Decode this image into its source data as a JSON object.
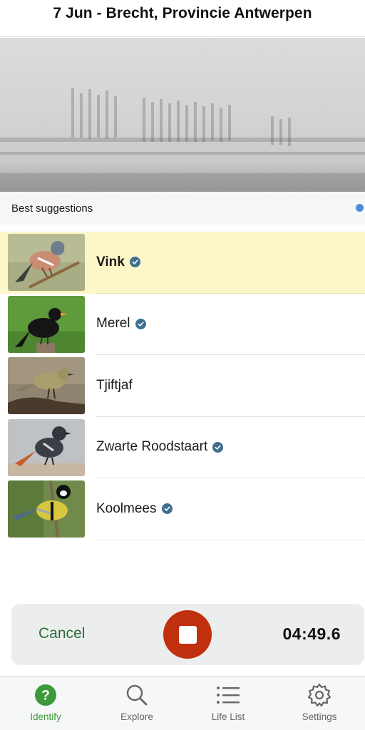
{
  "header": {
    "title": "7 Jun - Brecht, Provincie Antwerpen"
  },
  "suggestions": {
    "label": "Best suggestions",
    "items": [
      {
        "name": "Vink",
        "verified": true,
        "selected": true,
        "thumb_icon": "chaffinch-photo"
      },
      {
        "name": "Merel",
        "verified": true,
        "selected": false,
        "thumb_icon": "blackbird-photo"
      },
      {
        "name": "Tjiftjaf",
        "verified": false,
        "selected": false,
        "thumb_icon": "chiffchaff-photo"
      },
      {
        "name": "Zwarte Roodstaart",
        "verified": true,
        "selected": false,
        "thumb_icon": "black-redstart-photo"
      },
      {
        "name": "Koolmees",
        "verified": true,
        "selected": false,
        "thumb_icon": "great-tit-photo"
      }
    ]
  },
  "recording": {
    "cancel_label": "Cancel",
    "timer": "04:49.6",
    "stop_color": "#c1300e"
  },
  "tabs": [
    {
      "label": "Identify",
      "icon": "question-circle-icon",
      "active": true
    },
    {
      "label": "Explore",
      "icon": "search-icon",
      "active": false
    },
    {
      "label": "Life List",
      "icon": "list-icon",
      "active": false
    },
    {
      "label": "Settings",
      "icon": "gear-icon",
      "active": false
    }
  ],
  "colors": {
    "accent_green": "#3c9a3c",
    "selected_row": "#fdf6c8",
    "verified_badge": "#3f6f8f"
  }
}
